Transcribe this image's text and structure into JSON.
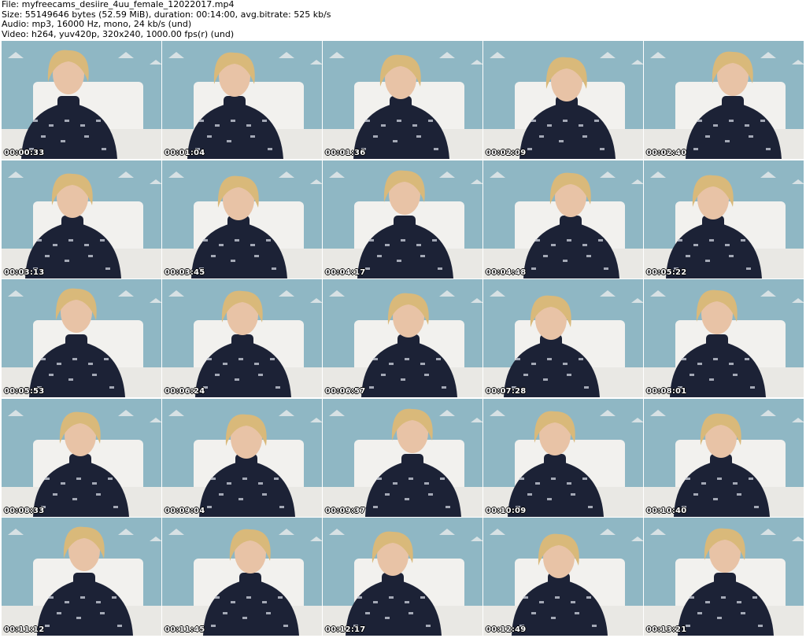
{
  "header": {
    "file_line": "File: myfreecams_desiire_4uu_female_12022017.mp4",
    "size_line": "Size: 55149646 bytes (52.59 MiB), duration: 00:14:00, avg.bitrate: 525 kb/s",
    "audio_line": "Audio: mp3, 16000 Hz, mono, 24 kb/s (und)",
    "video_line": "Video: h264, yuv420p, 320x240, 1000.00 fps(r) (und)"
  },
  "thumbnails": [
    "00:00:33",
    "00:01:04",
    "00:01:36",
    "00:02:09",
    "00:02:40",
    "00:03:13",
    "00:03:45",
    "00:04:17",
    "00:04:48",
    "00:05:22",
    "00:05:53",
    "00:06:24",
    "00:06:57",
    "00:07:28",
    "00:08:01",
    "00:08:33",
    "00:09:04",
    "00:09:37",
    "00:10:09",
    "00:10:40",
    "00:11:12",
    "00:11:45",
    "00:12:17",
    "00:12:49",
    "00:13:21"
  ],
  "colors": {
    "wall": "#8fb7c4",
    "headboard": "#f2f1ee",
    "sweater": "#1c2236",
    "hair": "#d9b97a",
    "skin": "#e8c3a6"
  }
}
